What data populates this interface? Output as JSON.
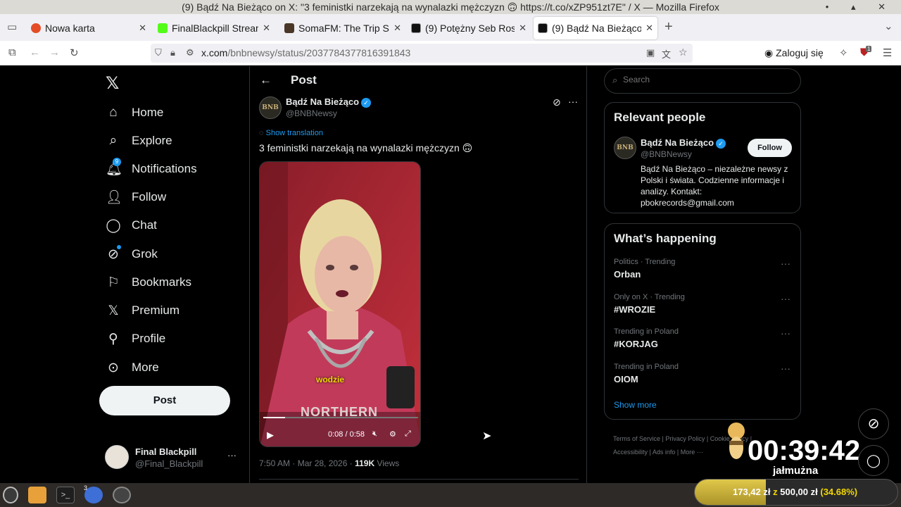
{
  "window": {
    "title": "(9) Bądź Na Bieżąco on X: \"3 feministki narzekają na wynalazki mężczyzn 🙃 https://t.co/xZP951zt7E\" / X — Mozilla Firefox",
    "controls": "• ▴ ✕"
  },
  "tabs": [
    {
      "label": "Nowa karta",
      "color": "#e44d26"
    },
    {
      "label": "FinalBlackpill Stream",
      "color": "#53fc18"
    },
    {
      "label": "SomaFM: The Trip So",
      "color": "#4a3728"
    },
    {
      "label": "(9) Potężny Seb Ross",
      "color": "#111111"
    },
    {
      "label": "(9) Bądź Na Bieżąco",
      "color": "#111111"
    }
  ],
  "navbar": {
    "url_domain": "x.com",
    "url_path": "/bnbnewsy/status/2037784377816391843",
    "login_label": "Zaloguj się",
    "ext_badge": "1"
  },
  "nav": {
    "items": [
      {
        "label": "Home",
        "icon": "⌂"
      },
      {
        "label": "Explore",
        "icon": "⌕"
      },
      {
        "label": "Notifications",
        "icon": "🔔︎",
        "badge": "9"
      },
      {
        "label": "Follow",
        "icon": "👤︎"
      },
      {
        "label": "Chat",
        "icon": "◯"
      },
      {
        "label": "Grok",
        "icon": "⊘"
      },
      {
        "label": "Bookmarks",
        "icon": "⚐"
      },
      {
        "label": "Premium",
        "icon": "𝕏"
      },
      {
        "label": "Profile",
        "icon": "⚲"
      },
      {
        "label": "More",
        "icon": "⊙"
      }
    ],
    "post_label": "Post",
    "account_name": "Final Blackpill",
    "account_handle": "@Final_Blackpill"
  },
  "post": {
    "header": "Post",
    "author_name": "Bądź Na Bieżąco",
    "author_handle": "@BNBNewsy",
    "avatar_text": "BNB",
    "show_translation": "Show translation",
    "text": "3 feministki narzekają na wynalazki mężczyzn 🙃",
    "caption": "wodzie",
    "shirt_text": "NORTHERN",
    "video_time": "0:08 / 0:58",
    "video_progress": 0.14,
    "timestamp": "7:50 AM · Mar 28, 2026 · ",
    "views_count": "119K",
    "views_label": "Views"
  },
  "search": {
    "placeholder": "Search"
  },
  "relevant": {
    "title": "Relevant people",
    "name": "Bądź Na Bieżąco",
    "handle": "@BNBNewsy",
    "follow_label": "Follow",
    "bio": "Bądź Na Bieżąco – niezależne newsy z Polski i świata. Codzienne informacje i analizy. Kontakt: pbokrecords@gmail.com"
  },
  "happening": {
    "title": "What’s happening",
    "trends": [
      {
        "category": "Politics · Trending",
        "name": "Orban"
      },
      {
        "category": "Only on X · Trending",
        "name": "#WROZIE"
      },
      {
        "category": "Trending in Poland",
        "name": "#KORJAG"
      },
      {
        "category": "Trending in Poland",
        "name": "OIOM"
      }
    ],
    "show_more": "Show more"
  },
  "footer_links": [
    "Terms of Service",
    "Privacy Policy",
    "Cookie Policy",
    "Accessibility",
    "Ads info",
    "More ···"
  ],
  "overlay": {
    "timer": "00:39:42",
    "label": "jałmużna",
    "donation_current": "173,42 zł",
    "donation_sep": "z",
    "donation_goal": "500,00 zł",
    "donation_percent": "(34.68%)",
    "donation_fraction": 0.3468
  },
  "taskbar": {
    "firefox_count": "3"
  },
  "colors": {
    "accent": "#1d9bf0",
    "x_bg": "#000000",
    "donation_bar": "#c9b53a"
  }
}
